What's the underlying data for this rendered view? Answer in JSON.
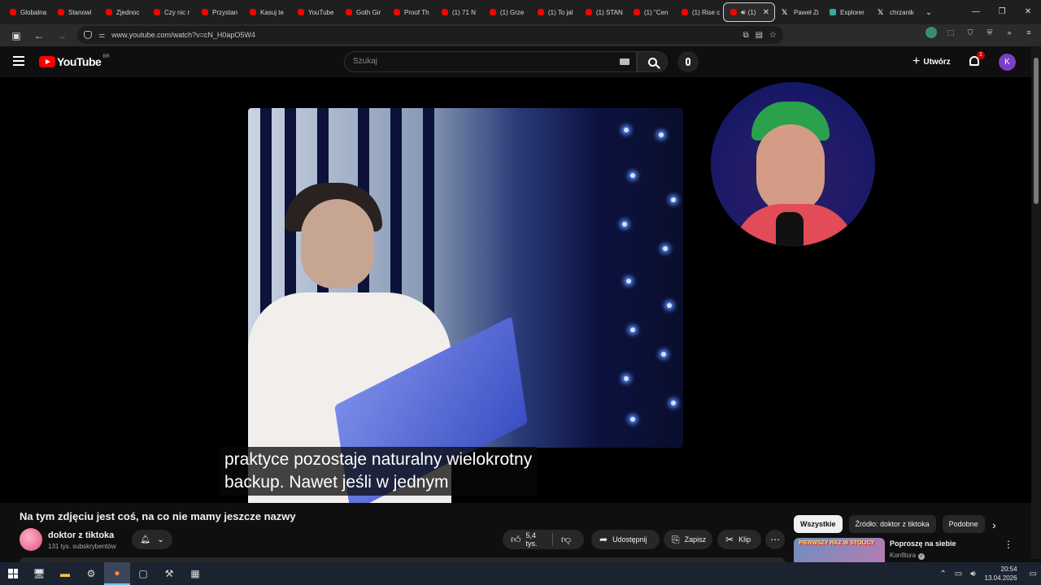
{
  "browser": {
    "tabs": [
      {
        "label": "Globalna",
        "icon": "youtube"
      },
      {
        "label": "Stanowi",
        "icon": "youtube"
      },
      {
        "label": "Zjednoc",
        "icon": "youtube"
      },
      {
        "label": "Czy nic r",
        "icon": "youtube"
      },
      {
        "label": "Przystan",
        "icon": "youtube"
      },
      {
        "label": "Kasuj te",
        "icon": "youtube"
      },
      {
        "label": "YouTube",
        "icon": "youtube"
      },
      {
        "label": "Goth Gir",
        "icon": "youtube"
      },
      {
        "label": "Proof Th",
        "icon": "youtube"
      },
      {
        "label": "(1) 71 N",
        "icon": "youtube"
      },
      {
        "label": "(1) Grze",
        "icon": "youtube"
      },
      {
        "label": "(1) To jal",
        "icon": "youtube"
      },
      {
        "label": "(1) STAN",
        "icon": "youtube"
      },
      {
        "label": "(1) \"Cen",
        "icon": "youtube"
      },
      {
        "label": "(1) Rise c",
        "icon": "youtube"
      },
      {
        "label": "(1)",
        "icon": "youtube",
        "active": true
      },
      {
        "label": "Paweł Zi",
        "icon": "x"
      },
      {
        "label": "Explorer",
        "icon": "explorer"
      },
      {
        "label": "chrzanik",
        "icon": "x"
      }
    ],
    "url": "www.youtube.com/watch?v=cN_H0apO5W4"
  },
  "youtube": {
    "logo_text": "YouTube",
    "country_code": "BR",
    "search_placeholder": "Szukaj",
    "create_label": "Utwórz",
    "notification_count": "1",
    "account_initial": "K"
  },
  "video": {
    "captions": [
      "praktyce pozostaje naturalny wielokrotny",
      "backup. Nawet jeśli w jednym"
    ],
    "title": "Na tym zdjęciu jest coś, na co nie mamy jeszcze nazwy",
    "channel": "doktor z tiktoka",
    "subscribers": "131 tys. subskrybentów",
    "likes": "5,4 tys.",
    "share_label": "Udostępnij",
    "save_label": "Zapisz",
    "clip_label": "Klip"
  },
  "sidebar": {
    "chips": [
      "Wszystkie",
      "Źródło: doktor z tiktoka",
      "Podobne"
    ],
    "recommendation": {
      "thumb_text": "PIERWSZY RAZ W STOLICY",
      "title": "Poproszę na siebie",
      "channel": "Konfitura"
    }
  },
  "taskbar": {
    "time": "20:54",
    "date": "13.04.2026"
  }
}
